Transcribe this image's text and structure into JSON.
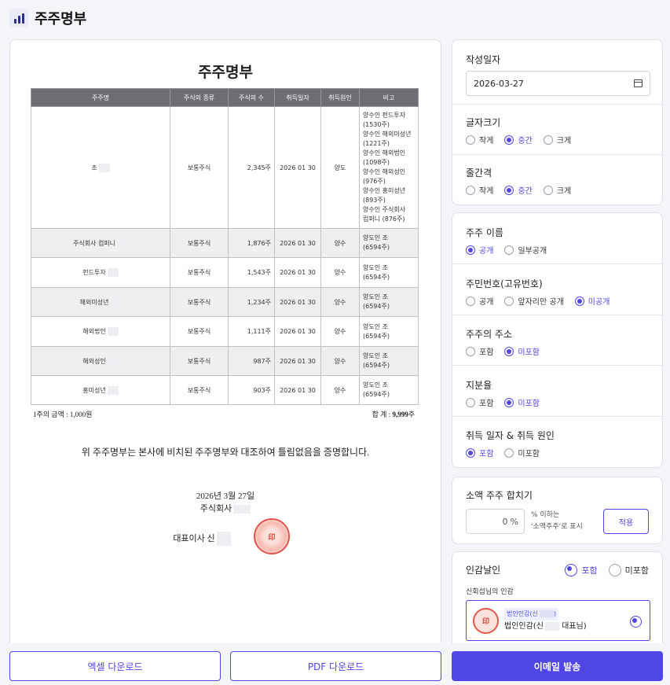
{
  "app": {
    "title": "주주명부"
  },
  "document": {
    "title": "주주명부",
    "columns": [
      "주주명",
      "주식의 종류",
      "주식의 수",
      "취득일자",
      "취득원인",
      "비고"
    ],
    "rows": [
      {
        "name": "조",
        "type": "보통주식",
        "count": "2,345주",
        "date": "2026 01 30",
        "cause": "양도",
        "notes": [
          "양수인 펀드투자",
          "(1530주)",
          "양수인 해외미성년",
          "(1221주)",
          "양수인 해외법인",
          "(1098주)",
          "양수인 해외성인",
          "(976주)",
          "양수인 홍미성년",
          "(893주)",
          "양수인 주식회사",
          "컴퍼니 (876주)"
        ]
      },
      {
        "name": "주식회사  컴퍼니",
        "type": "보통주식",
        "count": "1,876주",
        "date": "2026 01 30",
        "cause": "양수",
        "notes": [
          "양도인 조",
          "(6594주)"
        ]
      },
      {
        "name": "펀드투자",
        "type": "보통주식",
        "count": "1,543주",
        "date": "2026 01 30",
        "cause": "양수",
        "notes": [
          "양도인 조",
          "(6594주)"
        ]
      },
      {
        "name": "해외미성년",
        "type": "보통주식",
        "count": "1,234주",
        "date": "2026 01 30",
        "cause": "양수",
        "notes": [
          "양도인 조",
          "(6594주)"
        ]
      },
      {
        "name": "해외법인",
        "type": "보통주식",
        "count": "1,111주",
        "date": "2026 01 30",
        "cause": "양수",
        "notes": [
          "양도인 조",
          "(6594주)"
        ]
      },
      {
        "name": "해외성인",
        "type": "보통주식",
        "count": "987주",
        "date": "2026 01 30",
        "cause": "양수",
        "notes": [
          "양도인 조",
          "(6594주)"
        ]
      },
      {
        "name": "홍미성년",
        "type": "보통주식",
        "count": "903주",
        "date": "2026 01 30",
        "cause": "양수",
        "notes": [
          "양도인 조",
          "(6594주)"
        ]
      }
    ],
    "price_note": "1주의 금액 : 1,000원",
    "total_label": "합    계 : ",
    "total_value": "9,999",
    "total_unit": "주",
    "certify_text": "위 주주명부는 본사에 비치된 주주명부와 대조하여 틀림없음을 증명합니다.",
    "sign_date": "2026년 3월 27일",
    "sign_company": "주식회사",
    "sign_rep": "대표이사 신",
    "seal_text": "印"
  },
  "settings": {
    "date": {
      "label": "작성일자",
      "value": "2026-03-27"
    },
    "font_size": {
      "label": "글자크기",
      "options": [
        "작게",
        "중간",
        "크게"
      ],
      "selected": 1
    },
    "line_spacing": {
      "label": "줄간격",
      "options": [
        "작게",
        "중간",
        "크게"
      ],
      "selected": 1
    },
    "shareholder_name": {
      "label": "주주 이름",
      "options": [
        "공개",
        "일부공개"
      ],
      "selected": 0
    },
    "resident_no": {
      "label": "주민번호(고유번호)",
      "options": [
        "공개",
        "앞자리만 공개",
        "미공개"
      ],
      "selected": 2
    },
    "address": {
      "label": "주주의 주소",
      "options": [
        "포함",
        "미포함"
      ],
      "selected": 1
    },
    "ratio": {
      "label": "지분율",
      "options": [
        "포함",
        "미포함"
      ],
      "selected": 1
    },
    "acq": {
      "label": "취득 일자 & 취득 원인",
      "options": [
        "포함",
        "미포함"
      ],
      "selected": 0
    },
    "small": {
      "label": "소액 주주 합치기",
      "value": "0",
      "unit": "%",
      "desc1": "% 이하는",
      "desc2": "'소액주주'로 표시",
      "apply": "적용"
    },
    "seal": {
      "label": "인감날인",
      "options": [
        "포함",
        "미포함"
      ],
      "selected": 0,
      "owner_label": "신회섭님의 인감",
      "badge": "법인인감(신",
      "item": "법인인감(신",
      "item_suffix": "대표님)",
      "seal_mini": "印"
    }
  },
  "actions": {
    "excel": "엑셀 다운로드",
    "pdf": "PDF 다운로드",
    "email": "이메일 발송"
  },
  "colors": {
    "accent": "#4f46e5",
    "header": "#6c6e73",
    "seal": "#e1584b"
  }
}
